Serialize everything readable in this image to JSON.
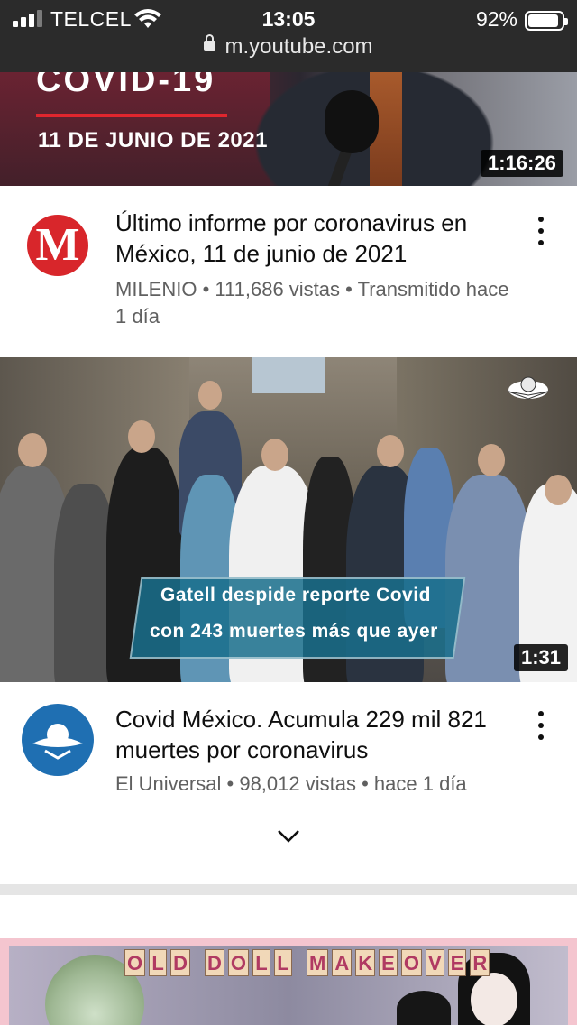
{
  "status_bar": {
    "carrier": "TELCEL",
    "time": "13:05",
    "battery_percent": "92%",
    "battery_level": 0.92,
    "signal_bars": 3,
    "signal_bars_max": 4
  },
  "browser": {
    "url": "m.youtube.com"
  },
  "videos": [
    {
      "thumbnail_title": "COVID-19",
      "thumbnail_date": "11 DE JUNIO DE 2021",
      "duration": "1:16:26",
      "title": "Último informe por coronavirus en México, 11 de junio de 2021",
      "channel": "MILENIO",
      "channel_avatar_letter": "M",
      "views": "111,686 vistas",
      "age": "Transmitido hace 1 día",
      "accent_color": "#d8262b"
    },
    {
      "overlay_line1": "Gatell despide reporte Covid",
      "overlay_line2": "con 243 muertes más que ayer",
      "duration": "1:31",
      "title": "Covid México. Acumula 229 mil 821 muertes por coronavirus",
      "channel": "El Universal",
      "views": "98,012 vistas",
      "age": "hace 1 día",
      "accent_color": "#1f6fb2"
    },
    {
      "thumbnail_text": "OLD DOLL MAKEOVER"
    }
  ],
  "separator": "•",
  "icons": {
    "menu": "kebab-menu-icon",
    "expand": "chevron-down-icon",
    "lock": "lock-icon",
    "wifi": "wifi-icon",
    "battery": "battery-icon"
  }
}
